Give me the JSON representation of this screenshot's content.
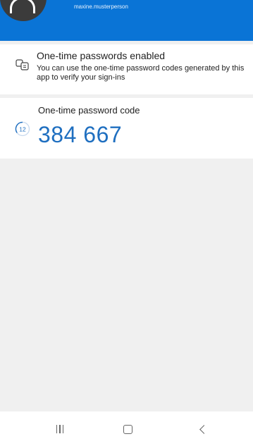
{
  "account": {
    "username": "maxine.musterperson"
  },
  "otp_enabled": {
    "title": "One-time passwords enabled",
    "description": "You can use the one-time password codes generated by this app to verify your sign-ins",
    "icon": "otp-devices-icon"
  },
  "otp_code": {
    "title": "One-time password code",
    "code": "384 667",
    "timer_seconds": "12"
  },
  "navbar": {
    "recents_icon": "recents-icon",
    "home_icon": "home-icon",
    "back_icon": "back-icon"
  },
  "colors": {
    "header": "#0a74d6",
    "code": "#1f6fc0",
    "background": "#f0f0f0"
  }
}
